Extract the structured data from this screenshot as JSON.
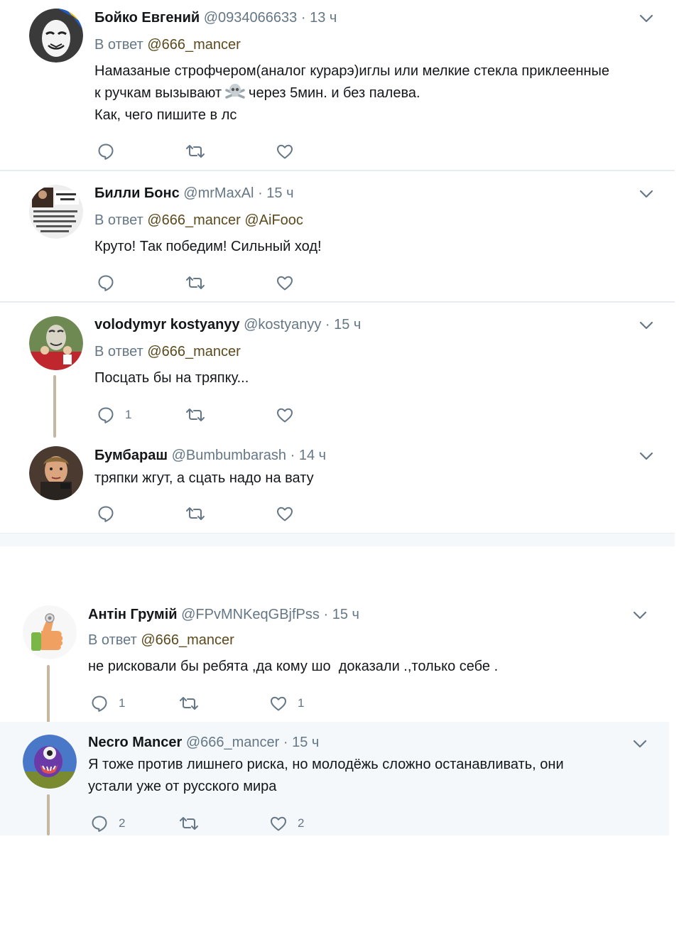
{
  "reply_prefix": "В ответ",
  "tweets": [
    {
      "name": "Бойко Евгений",
      "handle": "@0934066633",
      "sep": "·",
      "time": "13 ч",
      "mentions": [
        "@666_mancer"
      ],
      "text_line1": "Намазаные строфчером(аналог курарэ)иглы или мелкие стекла приклеенные",
      "text_line2a": "к ручкам вызывают",
      "emoji": "skull-and-crossbones",
      "text_line2b": "через 5мин. и без палева.",
      "text_line3": "Как, чего пишите в лс",
      "replies": "",
      "retweets": "",
      "likes": ""
    },
    {
      "name": "Билли Бонс",
      "handle": "@mrMaxAl",
      "sep": "·",
      "time": "15 ч",
      "mentions": [
        "@666_mancer",
        "@AiFooc"
      ],
      "text": "Круто! Так победим! Сильный ход!",
      "replies": "",
      "retweets": "",
      "likes": ""
    },
    {
      "name": "volodymyr kostyanyy",
      "handle": "@kostyanyy",
      "sep": "·",
      "time": "15 ч",
      "mentions": [
        "@666_mancer"
      ],
      "text": "Посцать бы на тряпку...",
      "replies": "1",
      "retweets": "",
      "likes": ""
    },
    {
      "name": "Бумбараш",
      "handle": "@Bumbumbarash",
      "sep": "·",
      "time": "14 ч",
      "text": "тряпки жгут, а сцать надо на вату",
      "replies": "",
      "retweets": "",
      "likes": ""
    },
    {
      "name": "Антін Грумій",
      "handle": "@FPvMNKeqGBjfPss",
      "sep": "·",
      "time": "15 ч",
      "mentions": [
        "@666_mancer"
      ],
      "text": "не рисковали бы ребята ,да кому шо  доказали .,только себе .",
      "replies": "1",
      "retweets": "",
      "likes": "1"
    },
    {
      "name": "Necro Mancer",
      "handle": "@666_mancer",
      "sep": "·",
      "time": "15 ч",
      "text_line1": "Я тоже против лишнего риска, но молодёжь сложно останавливать, они",
      "text_line2": "устали уже от русского мира",
      "replies": "2",
      "retweets": "",
      "likes": "2"
    }
  ],
  "colors": {
    "text": "#14171a",
    "muted": "#657786",
    "mention": "#5c4a1e",
    "separator": "#e6ecf0",
    "highlight": "#f5f8fa",
    "thread": "#c4b8a0"
  },
  "icons": {
    "reply": "reply-icon",
    "retweet": "retweet-icon",
    "like": "like-icon",
    "menu": "chevron-down-icon"
  }
}
